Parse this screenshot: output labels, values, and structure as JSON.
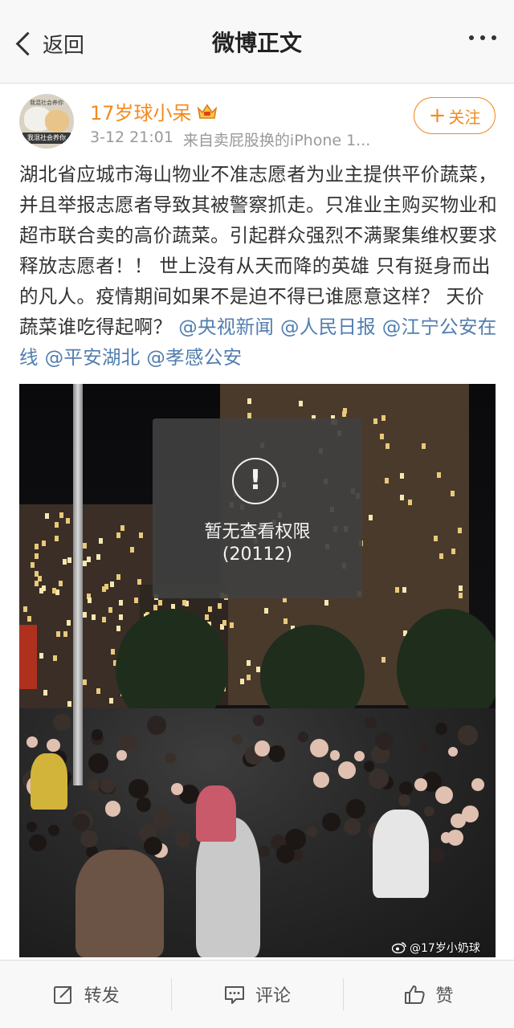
{
  "header": {
    "back_label": "返回",
    "title": "微博正文"
  },
  "post": {
    "author": "17岁球小呆",
    "time": "3-12 21:01",
    "source": "来自卖屁股换的iPhone 1...",
    "follow_label": "关注",
    "avatar_caption": "我混社会养你",
    "avatar_top_text": "我混社会养你",
    "text_main": "湖北省应城市海山物业不准志愿者为业主提供平价蔬菜，并且举报志愿者导致其被警察抓走。只准业主购买物业和超市联合卖的高价蔬菜。引起群众强烈不满聚集维权要求释放志愿者！！ 世上没有从天而降的英雄 只有挺身而出的凡人。疫情期间如果不是迫不得已谁愿意这样？  天价蔬菜谁吃得起啊？",
    "mentions": [
      "@央视新闻",
      "@人民日报",
      "@江宁公安在线",
      "@平安湖北",
      "@孝感公安"
    ],
    "image_overlay": {
      "icon": "exclamation-icon",
      "message": "暂无查看权限",
      "code": "(20112)"
    },
    "image_watermark": "@17岁小奶球"
  },
  "actions": {
    "repost": "转发",
    "comment": "评论",
    "like": "赞"
  },
  "colors": {
    "username": "#f38a1c",
    "mention": "#507daf",
    "follow": "#f38a1c"
  }
}
